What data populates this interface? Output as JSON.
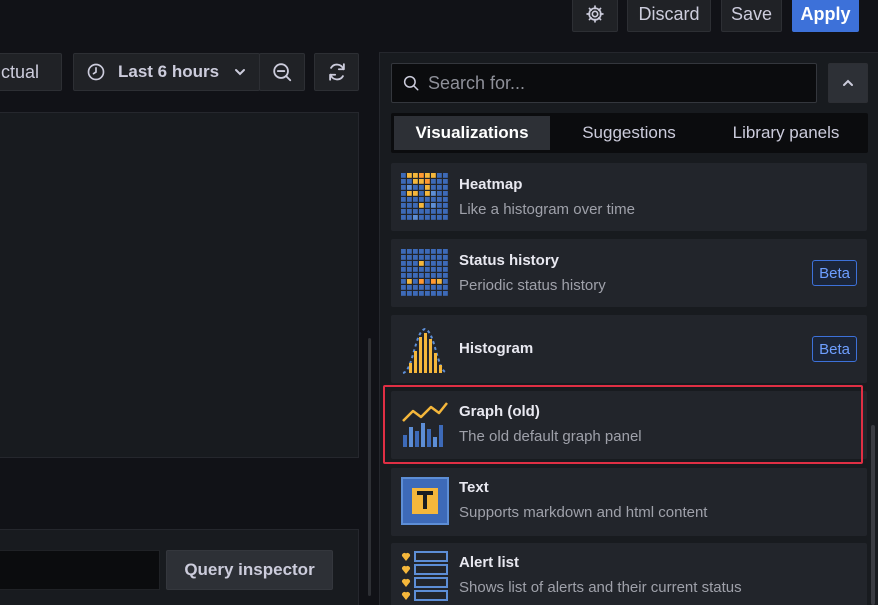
{
  "toolbar": {
    "discard_label": "Discard",
    "save_label": "Save",
    "apply_label": "Apply",
    "time_range_label": "Last 6 hours",
    "left_partial_label": "ctual"
  },
  "query": {
    "inspector_label": "Query inspector"
  },
  "picker": {
    "search_placeholder": "Search for...",
    "tabs": [
      {
        "label": "Visualizations"
      },
      {
        "label": "Suggestions"
      },
      {
        "label": "Library panels"
      }
    ],
    "items": [
      {
        "title": "Heatmap",
        "description": "Like a histogram over time",
        "icon": "heatmap-icon"
      },
      {
        "title": "Status history",
        "description": "Periodic status history",
        "icon": "status-history-icon",
        "badge": "Beta"
      },
      {
        "title": "Histogram",
        "description": "",
        "icon": "histogram-icon",
        "badge": "Beta"
      },
      {
        "title": "Graph (old)",
        "description": "The old default graph panel",
        "icon": "graph-old-icon"
      },
      {
        "title": "Text",
        "description": "Supports markdown and html content",
        "icon": "text-icon"
      },
      {
        "title": "Alert list",
        "description": "Shows list of alerts and their current status",
        "icon": "alert-list-icon"
      }
    ]
  },
  "colors": {
    "accent": "#3d71d9",
    "highlight": "#e02f44",
    "icon_blue": "#3d6ab8",
    "icon_light_blue": "#5d8ed6",
    "icon_yellow": "#f5b73b",
    "icon_orange": "#ff9830"
  }
}
